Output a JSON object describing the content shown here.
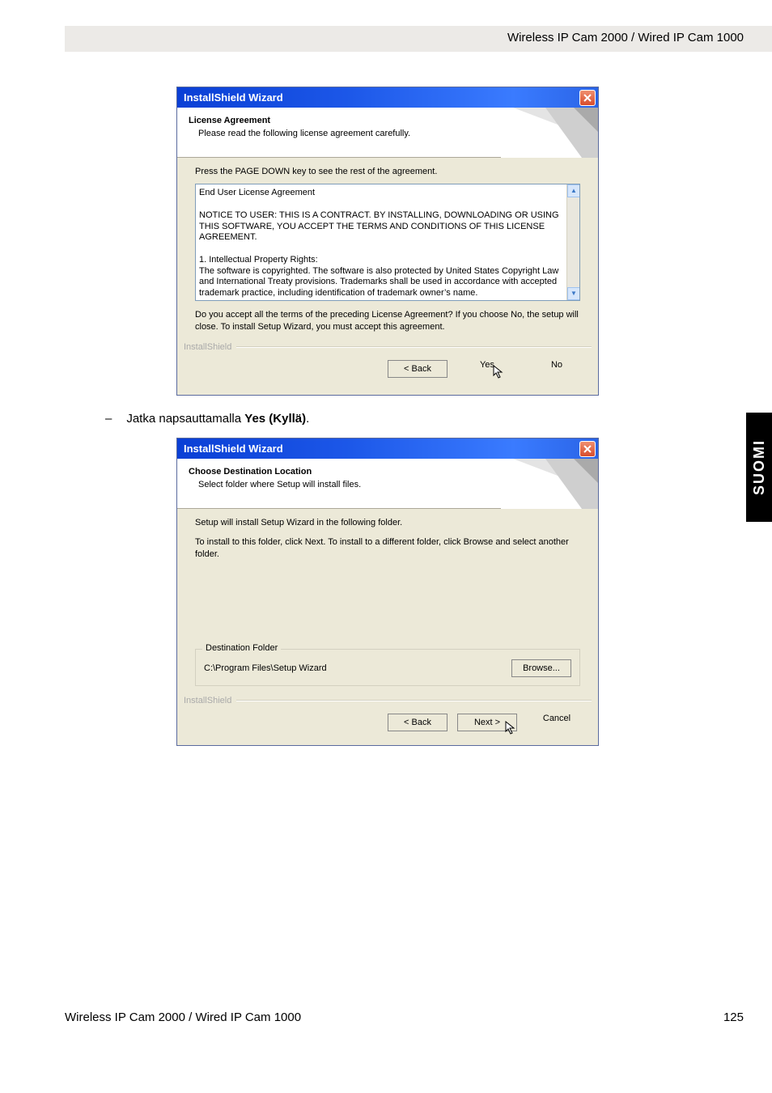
{
  "header_product": "Wireless IP Cam 2000 / Wired IP Cam 1000",
  "side_tab": "SUOMI",
  "footer_left": "Wireless IP Cam 2000 / Wired IP Cam 1000",
  "footer_page": "125",
  "instruction": {
    "prefix": "Jatka napsauttamalla ",
    "bold": "Yes (Kyllä)",
    "suffix": "."
  },
  "dialog1": {
    "title": "InstallShield Wizard",
    "heading": "License Agreement",
    "subheading": "Please read the following license agreement carefully.",
    "press_pagedown": "Press the PAGE DOWN key to see the rest of the agreement.",
    "eula_line1": "End User License Agreement",
    "eula_p1": "NOTICE TO USER:  THIS IS A CONTRACT.  BY INSTALLING, DOWNLOADING OR USING THIS SOFTWARE, YOU ACCEPT THE TERMS AND CONDITIONS OF THIS LICENSE AGREEMENT.",
    "eula_h2": "1.  Intellectual Property Rights:",
    "eula_p2": "The software is copyrighted.  The software is also protected by United States Copyright Law and International Treaty provisions.  Trademarks shall be used in accordance with accepted trademark practice, including identification of trademark owner’s name.",
    "accept_q": "Do you accept all the terms of the preceding License Agreement?  If you choose No,  the setup will close.  To install Setup Wizard, you must accept this agreement.",
    "brand": "InstallShield",
    "btn_back": "< Back",
    "btn_yes": "Yes",
    "btn_no": "No"
  },
  "dialog2": {
    "title": "InstallShield Wizard",
    "heading": "Choose Destination Location",
    "subheading": "Select folder where Setup will install files.",
    "line1": "Setup will install Setup Wizard in the following folder.",
    "line2": "To install to this folder, click Next. To install to a different folder, click Browse and select another folder.",
    "dest_legend": "Destination Folder",
    "dest_path": "C:\\Program Files\\Setup Wizard",
    "browse": "Browse...",
    "brand": "InstallShield",
    "btn_back": "< Back",
    "btn_next": "Next >",
    "btn_cancel": "Cancel"
  }
}
